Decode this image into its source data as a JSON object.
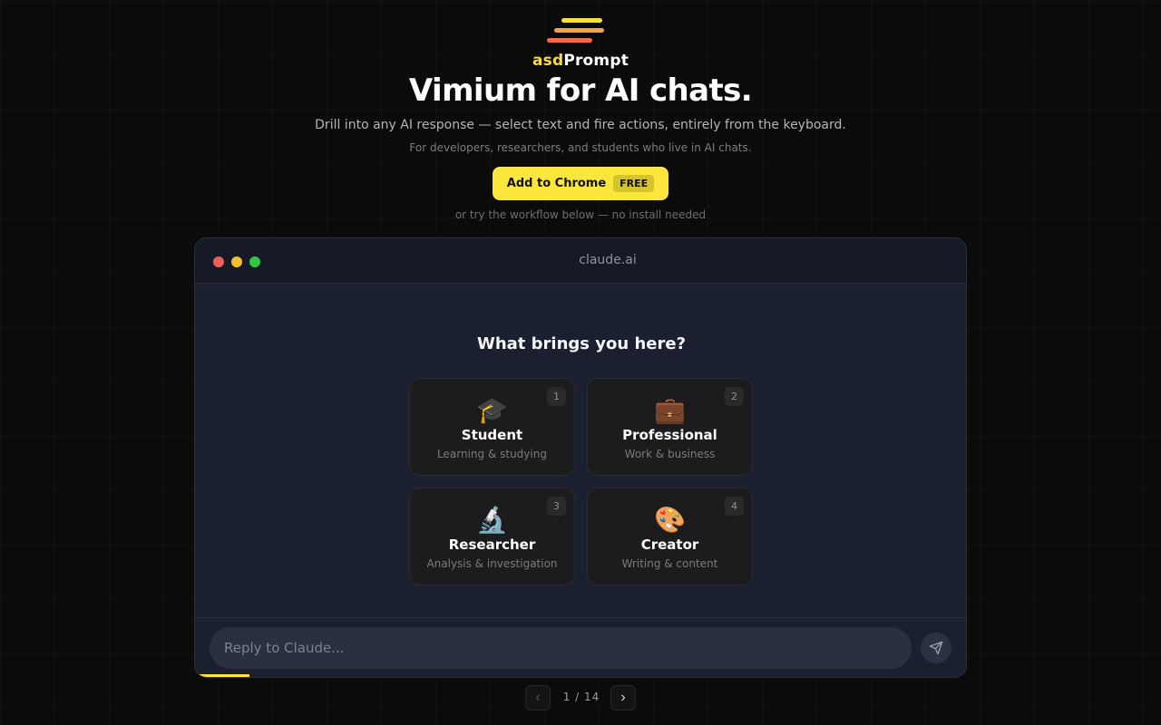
{
  "brand": {
    "prefix": "asd",
    "suffix": "Prompt"
  },
  "hero": {
    "headline": "Vimium for AI chats.",
    "subtitle": "Drill into any AI response — select text and fire actions, entirely from the keyboard.",
    "audience": "For developers, researchers, and students who live in AI chats.",
    "cta_label": "Add to Chrome",
    "cta_badge": "FREE",
    "alt_note": "or try the workflow below — no install needed"
  },
  "window": {
    "url": "claude.ai",
    "question": "What brings you here?",
    "options": [
      {
        "num": "1",
        "emoji": "🎓",
        "title": "Student",
        "desc": "Learning & studying"
      },
      {
        "num": "2",
        "emoji": "💼",
        "title": "Professional",
        "desc": "Work & business"
      },
      {
        "num": "3",
        "emoji": "🔬",
        "title": "Researcher",
        "desc": "Analysis & investigation"
      },
      {
        "num": "4",
        "emoji": "🎨",
        "title": "Creator",
        "desc": "Writing & content"
      }
    ],
    "reply_placeholder": "Reply to Claude...",
    "progress_fraction": 0.07
  },
  "pager": {
    "prev": "‹",
    "next": "›",
    "current": "1",
    "separator": "/",
    "total": "14"
  },
  "colors": {
    "accent": "#fbe73c",
    "background": "#0b0b0b",
    "window_bg": "#1b2030"
  }
}
